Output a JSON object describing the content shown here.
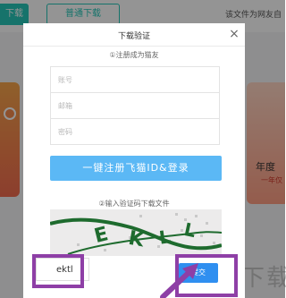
{
  "background": {
    "teal_button": "下载",
    "normal_download_button": "普通下载",
    "notice": "该文件为网友自",
    "right_card_title": "年度",
    "right_card_sub": "一年仅",
    "bottom_text": "下载"
  },
  "dialog": {
    "title": "下载验证",
    "close_icon": "×",
    "step1_label": "①注册成为猫友",
    "fields": {
      "account_placeholder": "账号",
      "email_placeholder": "邮箱",
      "password_placeholder": "密码"
    },
    "register_button": "一键注册飞猫ID&登录",
    "step2_label": "②输入验证码下载文件",
    "captcha_letters": [
      "E",
      "K",
      "L",
      "L"
    ],
    "code_input_value": "ektl",
    "submit_button": "提交"
  },
  "colors": {
    "accent": "#5bb8f5",
    "submit": "#2f8ff0",
    "highlight": "#8e3fa6",
    "teal": "#26c6b8"
  }
}
